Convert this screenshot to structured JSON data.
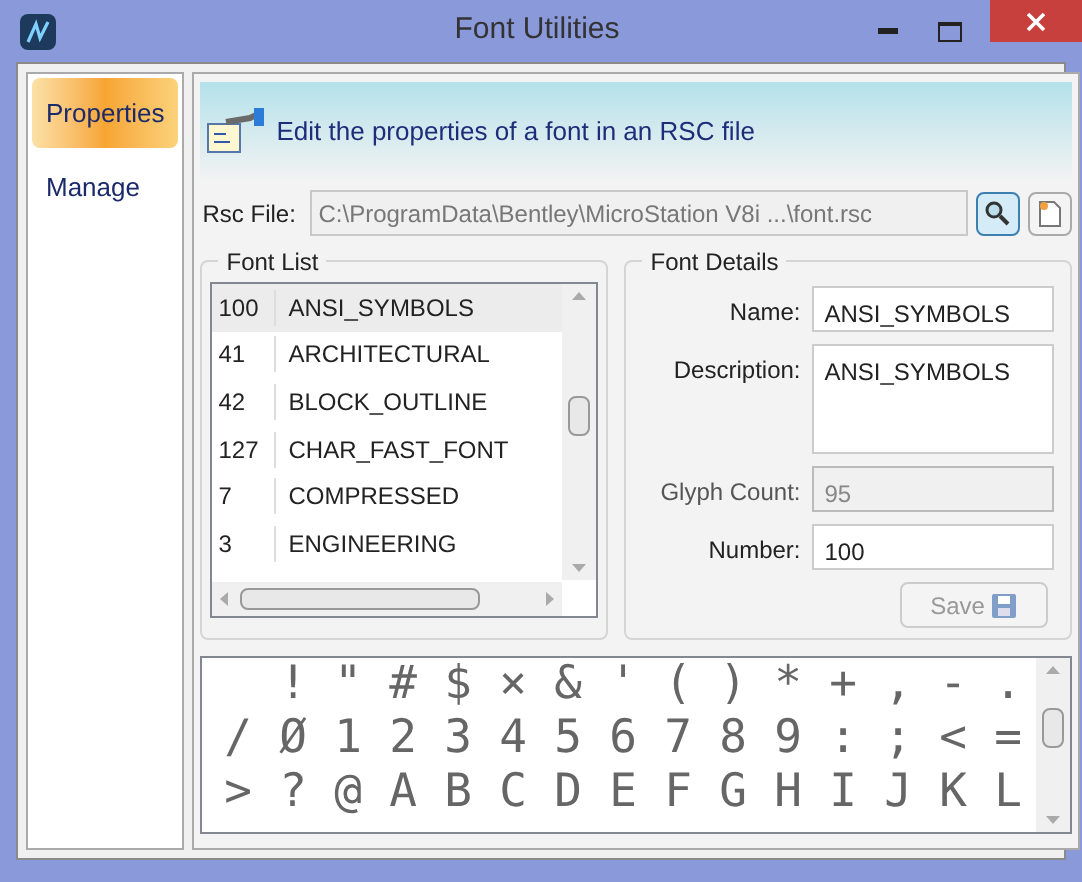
{
  "window": {
    "title": "Font Utilities"
  },
  "sidebar": {
    "items": [
      {
        "label": "Properties",
        "selected": true
      },
      {
        "label": "Manage",
        "selected": false
      }
    ]
  },
  "header": {
    "text": "Edit the properties of a font in an RSC file"
  },
  "rsc_file": {
    "label": "Rsc File:",
    "value": "C:\\ProgramData\\Bentley\\MicroStation V8i ...\\font.rsc"
  },
  "font_list": {
    "title": "Font List",
    "rows": [
      {
        "number": "100",
        "name": "ANSI_SYMBOLS",
        "selected": true
      },
      {
        "number": "41",
        "name": "ARCHITECTURAL",
        "selected": false
      },
      {
        "number": "42",
        "name": "BLOCK_OUTLINE",
        "selected": false
      },
      {
        "number": "127",
        "name": "CHAR_FAST_FONT",
        "selected": false
      },
      {
        "number": "7",
        "name": "COMPRESSED",
        "selected": false
      },
      {
        "number": "3",
        "name": "ENGINEERING",
        "selected": false
      }
    ]
  },
  "font_details": {
    "title": "Font Details",
    "fields": [
      {
        "label": "Name:",
        "value": "ANSI_SYMBOLS",
        "kind": "text",
        "disabled": false
      },
      {
        "label": "Description:",
        "value": "ANSI_SYMBOLS",
        "kind": "multiline",
        "disabled": false
      },
      {
        "label": "Glyph Count:",
        "value": "95",
        "kind": "text",
        "disabled": true
      },
      {
        "label": "Number:",
        "value": "100",
        "kind": "text",
        "disabled": false
      }
    ],
    "save_button": {
      "label": "Save",
      "disabled": true
    }
  },
  "glyphs": {
    "rows": [
      [
        "",
        "!",
        "\"",
        "#",
        "$",
        "×",
        "&",
        "'",
        "(",
        ")",
        "*",
        "+",
        ",",
        "-",
        "."
      ],
      [
        "/",
        "Ø",
        "1",
        "2",
        "3",
        "4",
        "5",
        "6",
        "7",
        "8",
        "9",
        ":",
        ";",
        "<",
        "="
      ],
      [
        ">",
        "?",
        "@",
        "A",
        "B",
        "C",
        "D",
        "E",
        "F",
        "G",
        "H",
        "I",
        "J",
        "K",
        "L"
      ]
    ]
  }
}
